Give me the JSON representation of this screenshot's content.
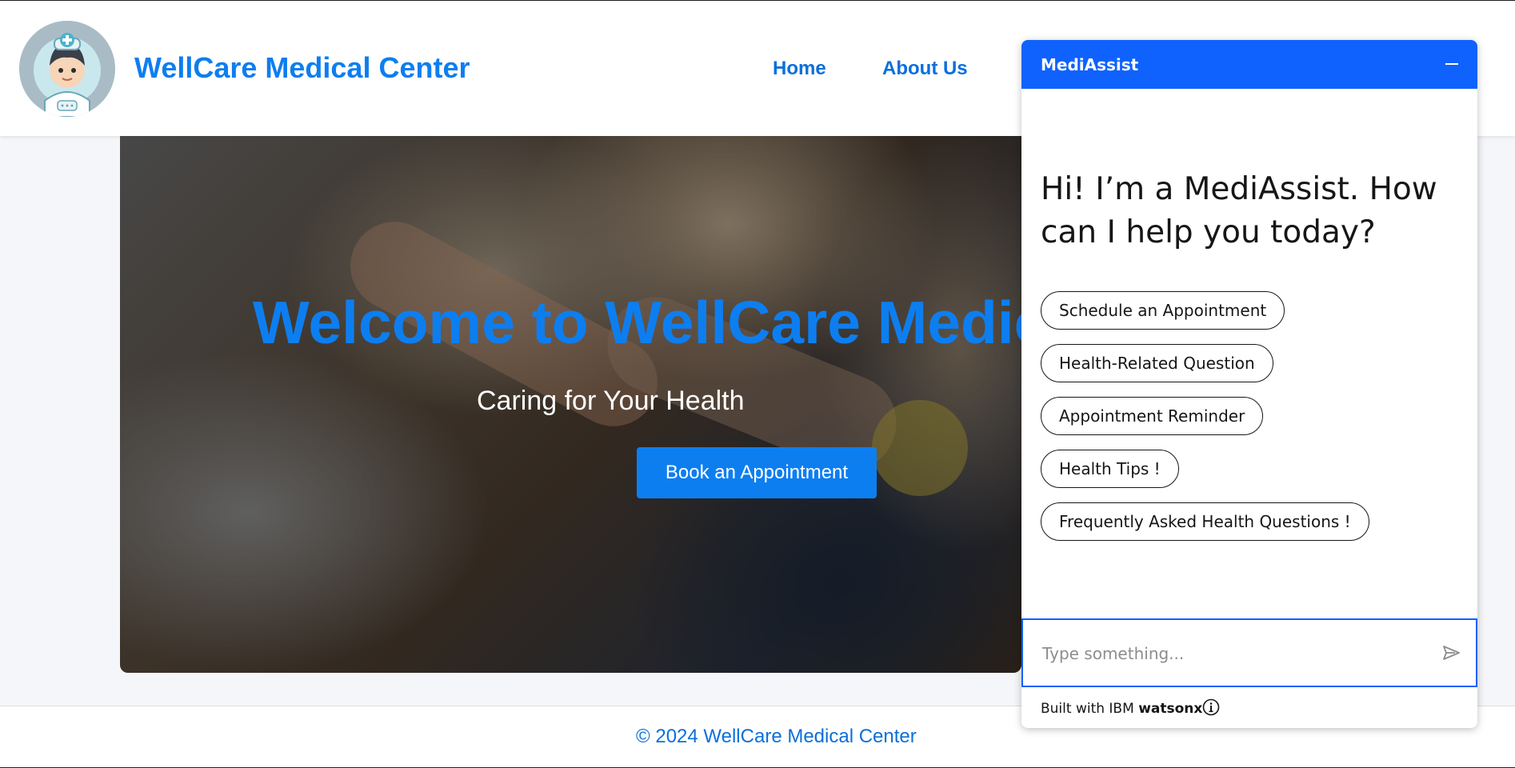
{
  "site": {
    "title": "WellCare Medical Center",
    "nav": [
      {
        "label": "Home"
      },
      {
        "label": "About Us"
      }
    ]
  },
  "hero": {
    "title": "Welcome to WellCare Medical Center",
    "subtitle": "Caring for Your Health",
    "cta_label": "Book an Appointment"
  },
  "footer": {
    "text": "© 2024 WellCare Medical Center"
  },
  "chat": {
    "title": "MediAssist",
    "greeting": "Hi! I’m a MediAssist. How can I help you today?",
    "options": [
      {
        "label": "Schedule an Appointment"
      },
      {
        "label": "Health-Related Question"
      },
      {
        "label": "Appointment Reminder"
      },
      {
        "label": "Health Tips !"
      },
      {
        "label": "Frequently Asked Health Questions !"
      }
    ],
    "input_placeholder": "Type something...",
    "built_with_prefix": "Built with IBM",
    "built_with_brand": "watsonx"
  },
  "colors": {
    "brand_blue": "#0d7ef0",
    "chat_blue": "#0f62fe"
  },
  "icons": [
    "doctor-avatar-icon",
    "minimize-icon",
    "send-icon",
    "info-icon"
  ]
}
